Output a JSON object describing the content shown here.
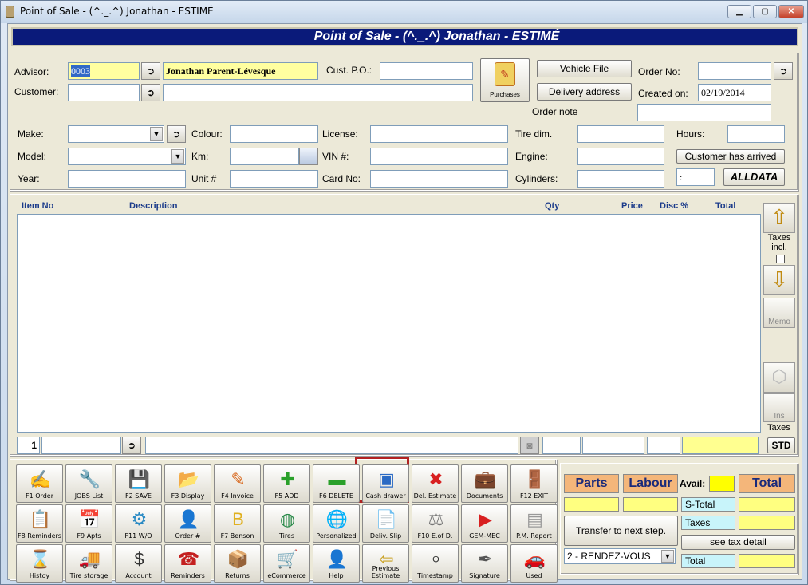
{
  "window": {
    "title": "Point of Sale - (^._.^) Jonathan - ESTIMÉ"
  },
  "header": {
    "title": "Point of Sale - (^._.^) Jonathan - ESTIMÉ"
  },
  "form": {
    "advisor_label": "Advisor:",
    "advisor_code": "0003",
    "advisor_name": "Jonathan Parent-Lévesque",
    "cust_po_label": "Cust. P.O.:",
    "cust_po": "",
    "customer_label": "Customer:",
    "customer_code": "",
    "customer_name": "",
    "purchases_label": "Purchases",
    "vehicle_file_label": "Vehicle File",
    "delivery_address_label": "Delivery address",
    "order_no_label": "Order No:",
    "order_no": "",
    "created_on_label": "Created on:",
    "created_on": "02/19/2014",
    "order_note_label": "Order note",
    "order_note": "",
    "make_label": "Make:",
    "model_label": "Model:",
    "year_label": "Year:",
    "colour_label": "Colour:",
    "km_label": "Km:",
    "unit_label": "Unit #",
    "license_label": "License:",
    "vin_label": "VIN #:",
    "card_no_label": "Card No:",
    "tire_dim_label": "Tire dim.",
    "engine_label": "Engine:",
    "cylinders_label": "Cylinders:",
    "hours_label": "Hours:",
    "customer_arrived_label": "Customer has arrived",
    "time_value": ":",
    "alldata_label": "ALLDATA"
  },
  "grid": {
    "columns": [
      "Item No",
      "Description",
      "Qty",
      "Price",
      "Disc %",
      "Total"
    ],
    "line_no": "1",
    "taxes_incl_label": "Taxes incl.",
    "memo_label": "Memo",
    "ins_label": "Ins",
    "taxes_label": "Taxes",
    "std_label": "STD"
  },
  "toolbar": {
    "rows": [
      [
        {
          "label": "F1 Order",
          "icon": "✍",
          "color": "#3b6bc4"
        },
        {
          "label": "JOBS List",
          "icon": "🔧",
          "color": "#777"
        },
        {
          "label": "F2 SAVE",
          "icon": "💾",
          "color": "#c9a020"
        },
        {
          "label": "F3 Display",
          "icon": "📂",
          "color": "#e0a020"
        },
        {
          "label": "F4 Invoice",
          "icon": "✎",
          "color": "#d86a20"
        },
        {
          "label": "F5 ADD",
          "icon": "✚",
          "color": "#2aa02a"
        },
        {
          "label": "F6 DELETE",
          "icon": "▬",
          "color": "#2aa02a"
        },
        {
          "label": "Cash drawer",
          "icon": "▣",
          "color": "#2a6ac4"
        },
        {
          "label": "Del. Estimate",
          "icon": "✖",
          "color": "#d82020"
        },
        {
          "label": "Documents",
          "icon": "💼",
          "color": "#333"
        },
        {
          "label": "F12 EXIT",
          "icon": "🚪",
          "color": "#c84020"
        }
      ],
      [
        {
          "label": "F8 Reminders",
          "icon": "📋",
          "color": "#3b6bc4"
        },
        {
          "label": "F9 Apts",
          "icon": "📅",
          "color": "#c42020"
        },
        {
          "label": "F11 W/O",
          "icon": "⚙",
          "color": "#2a8ac4"
        },
        {
          "label": "Order #",
          "icon": "👤",
          "color": "#777"
        },
        {
          "label": "F7 Benson",
          "icon": "B",
          "color": "#e0b020"
        },
        {
          "label": "Tires",
          "icon": "◍",
          "color": "#2a8a4a"
        },
        {
          "label": "Personalized",
          "icon": "🌐",
          "color": "#2a8a4a"
        },
        {
          "label": "Deliv. Slip",
          "icon": "📄",
          "color": "#2a8a4a"
        },
        {
          "label": "F10 E.of D.",
          "icon": "⚖",
          "color": "#777"
        },
        {
          "label": "GEM-MEC",
          "icon": "▶",
          "color": "#d82020"
        },
        {
          "label": "P.M. Report",
          "icon": "▤",
          "color": "#999"
        }
      ],
      [
        {
          "label": "Histoy",
          "icon": "⌛",
          "color": "#777"
        },
        {
          "label": "Tire storage",
          "icon": "🚚",
          "color": "#555"
        },
        {
          "label": "Account",
          "icon": "$",
          "color": "#333"
        },
        {
          "label": "Reminders",
          "icon": "☎",
          "color": "#c42020"
        },
        {
          "label": "Returns",
          "icon": "📦",
          "color": "#2aa02a"
        },
        {
          "label": "eCommerce",
          "icon": "🛒",
          "color": "#2a6ac4"
        },
        {
          "label": "Help",
          "icon": "👤",
          "color": "#d86a20"
        },
        {
          "label": "Previous Estimate",
          "icon": "⇦",
          "color": "#c9a020"
        },
        {
          "label": "Timestamp",
          "icon": "⌖",
          "color": "#333"
        },
        {
          "label": "Signature",
          "icon": "✒",
          "color": "#555"
        },
        {
          "label": "Used",
          "icon": "🚗",
          "color": "#d8c020"
        }
      ]
    ]
  },
  "totals": {
    "parts_label": "Parts",
    "labour_label": "Labour",
    "avail_label": "Avail:",
    "total_label": "Total",
    "s_total_label": "S-Total",
    "taxes_label": "Taxes",
    "total_row_label": "Total",
    "transfer_label": "Transfer to next step.",
    "see_tax_label": "see tax detail",
    "step_value": "2 - RENDEZ-VOUS"
  },
  "colors": {
    "header_bg": "#0a1a7a",
    "highlight": "#ffffa0",
    "selection_outline": "#b22222"
  }
}
